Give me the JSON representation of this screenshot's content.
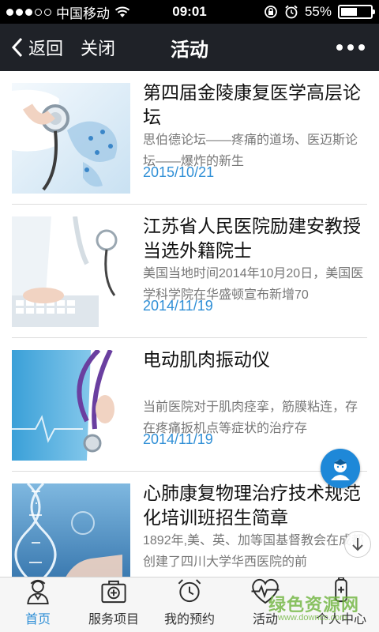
{
  "status": {
    "carrier": "中国移动",
    "time": "09:01",
    "battery": "55%",
    "battery_level": 0.55
  },
  "nav": {
    "back_label": "返回",
    "close_label": "关闭",
    "title": "活动"
  },
  "articles": [
    {
      "title": "第四届金陵康复医学高层论坛",
      "summary": "思伯德论坛——疼痛的道场、医迈斯论坛——爆炸的新生",
      "date": "2015/10/21",
      "image": "stethoscope-world-map"
    },
    {
      "title": "江苏省人民医院励建安教授当选外籍院士",
      "summary": "美国当地时间2014年10月20日，美国医学科学院在华盛顿宣布新增70",
      "date": "2014/11/19",
      "image": "doctor-keyboard"
    },
    {
      "title": "电动肌肉振动仪",
      "summary": "当前医院对于肌肉痉挛，筋膜粘连，存在疼痛扳机点等症状的治疗存",
      "date": "2014/11/19",
      "image": "doctor-stethoscope"
    },
    {
      "title": "心肺康复物理治疗技术规范化培训班招生简章",
      "summary": "1892年,美、英、加等国基督教会在成都创建了四川大学华西医院的前",
      "date": "",
      "image": "dna-hand"
    }
  ],
  "tabs": [
    {
      "label": "首页",
      "icon": "doctor-icon"
    },
    {
      "label": "服务项目",
      "icon": "medical-kit-icon"
    },
    {
      "label": "我的预约",
      "icon": "alarm-clock-icon"
    },
    {
      "label": "活动",
      "icon": "heartbeat-icon"
    },
    {
      "label": "个人中心",
      "icon": "person-icon"
    }
  ],
  "watermark": {
    "text": "绿色资源网",
    "url": "www.downcc.com"
  },
  "colors": {
    "accent": "#2f8fd6",
    "nav_bg": "#1f2228",
    "tab_bg": "#f6f6f6"
  }
}
